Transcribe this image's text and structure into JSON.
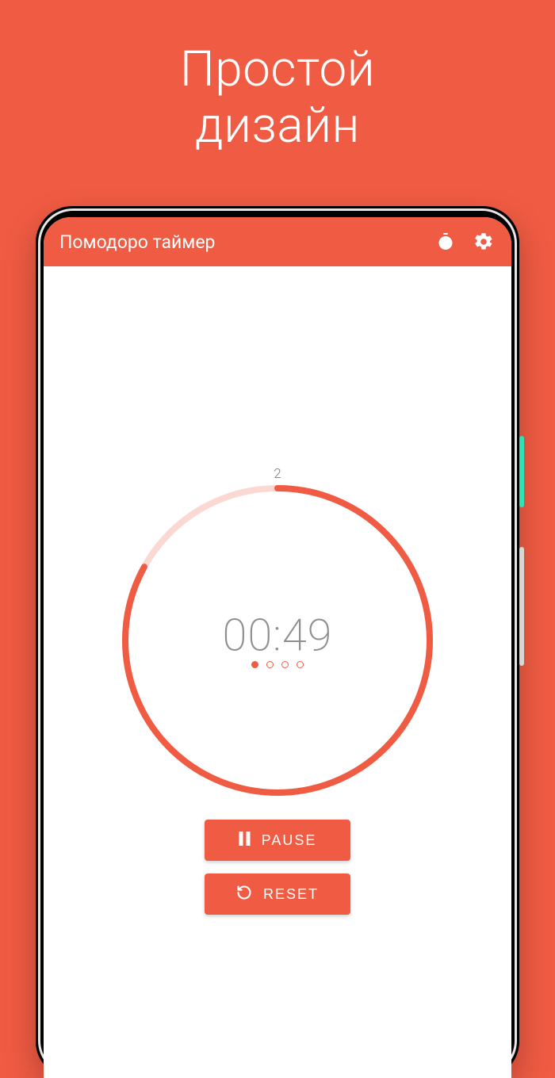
{
  "promo": {
    "line1": "Простой",
    "line2": "дизайн"
  },
  "appbar": {
    "title": "Помодоро таймер"
  },
  "timer": {
    "session": "2",
    "time": "00:49",
    "progress_pct": 83,
    "dots_total": 4,
    "dots_filled": 1
  },
  "buttons": {
    "pause": "PAUSE",
    "reset": "RESET"
  },
  "colors": {
    "accent": "#f05b43"
  }
}
